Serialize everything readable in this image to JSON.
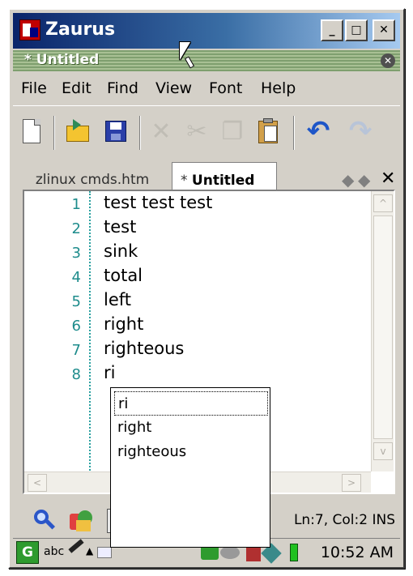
{
  "window": {
    "title": "Zaurus",
    "controls": {
      "minimize": "_",
      "maximize": "□",
      "close": "✕"
    }
  },
  "document": {
    "caption": "* Untitled",
    "close_glyph": "✕"
  },
  "menu": [
    "File",
    "Edit",
    "Find",
    "View",
    "Font",
    "Help"
  ],
  "toolbar": {
    "icons": [
      "new-document-icon",
      "open-icon",
      "save-icon",
      "cut-icon",
      "copy-icon",
      "paste-icon",
      "undo-icon",
      "redo-icon"
    ],
    "cut_glyph": "✕",
    "copy_glyph": "❐",
    "undo_glyph": "↶",
    "redo_glyph": "↷"
  },
  "tabs": [
    {
      "label": "zlinux cmds.htm",
      "active": false
    },
    {
      "star": "* ",
      "label": "Untitled",
      "active": true
    }
  ],
  "tab_nav": {
    "back": "◆",
    "forward": "◆",
    "close": "✕"
  },
  "editor": {
    "line_numbers": [
      "1",
      "2",
      "3",
      "4",
      "5",
      "6",
      "7",
      "8"
    ],
    "lines": [
      "test test test",
      "test",
      "sink",
      "total",
      "left",
      "right",
      "righteous",
      "ri"
    ]
  },
  "autocomplete": {
    "items": [
      "ri",
      "right",
      "righteous"
    ],
    "selected_index": 0
  },
  "scroll": {
    "up": "^",
    "down": "v",
    "left": "<",
    "right": ">"
  },
  "status": {
    "position": "Ln:7, Col:2 INS"
  },
  "taskbar": {
    "start": "G",
    "input_mode": "abc",
    "up_arrow": "▲",
    "clock": "10:52 AM"
  },
  "colors": {
    "title_gradient_start": "#0a246a",
    "line_number": "#1e8c8c",
    "window_face": "#d4d0c8"
  }
}
